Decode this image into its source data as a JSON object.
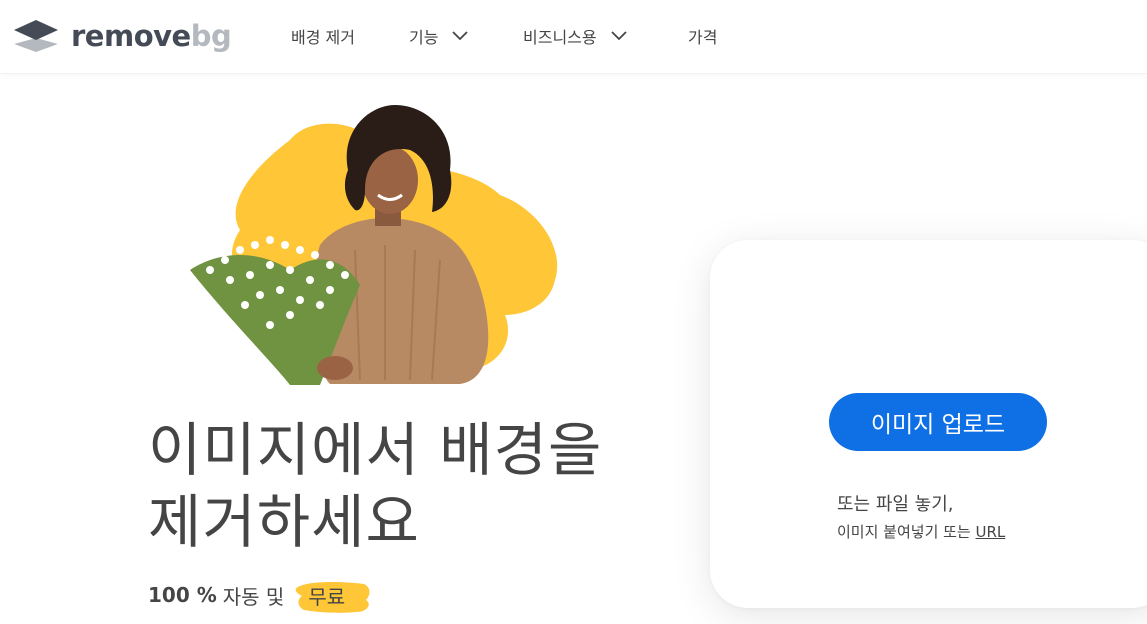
{
  "brand": {
    "name_part1": "remove",
    "name_part2": "bg",
    "colors": {
      "dark": "#454b56",
      "light": "#b4b9c0"
    }
  },
  "nav": {
    "items": [
      {
        "label": "배경 제거",
        "has_dropdown": false
      },
      {
        "label": "기능",
        "has_dropdown": true,
        "icon": "chevron-down-icon"
      },
      {
        "label": "비즈니스용",
        "has_dropdown": true,
        "icon": "chevron-down-icon"
      },
      {
        "label": "가격",
        "has_dropdown": false
      }
    ]
  },
  "hero": {
    "image_description_icon": "woman-with-flowers-illustration",
    "headline_line1": "이미지에서 배경을",
    "headline_line2": "제거하세요",
    "sub_percent": "100 %",
    "sub_auto": "자동 및",
    "sub_free": "무료",
    "accent_color": "#ffc738"
  },
  "upload": {
    "button_label": "이미지 업로드",
    "drop_text": "또는 파일 놓기,",
    "paste_text": "이미지 붙여넣기 또는",
    "url_link": "URL",
    "button_color": "#0f70e6"
  }
}
